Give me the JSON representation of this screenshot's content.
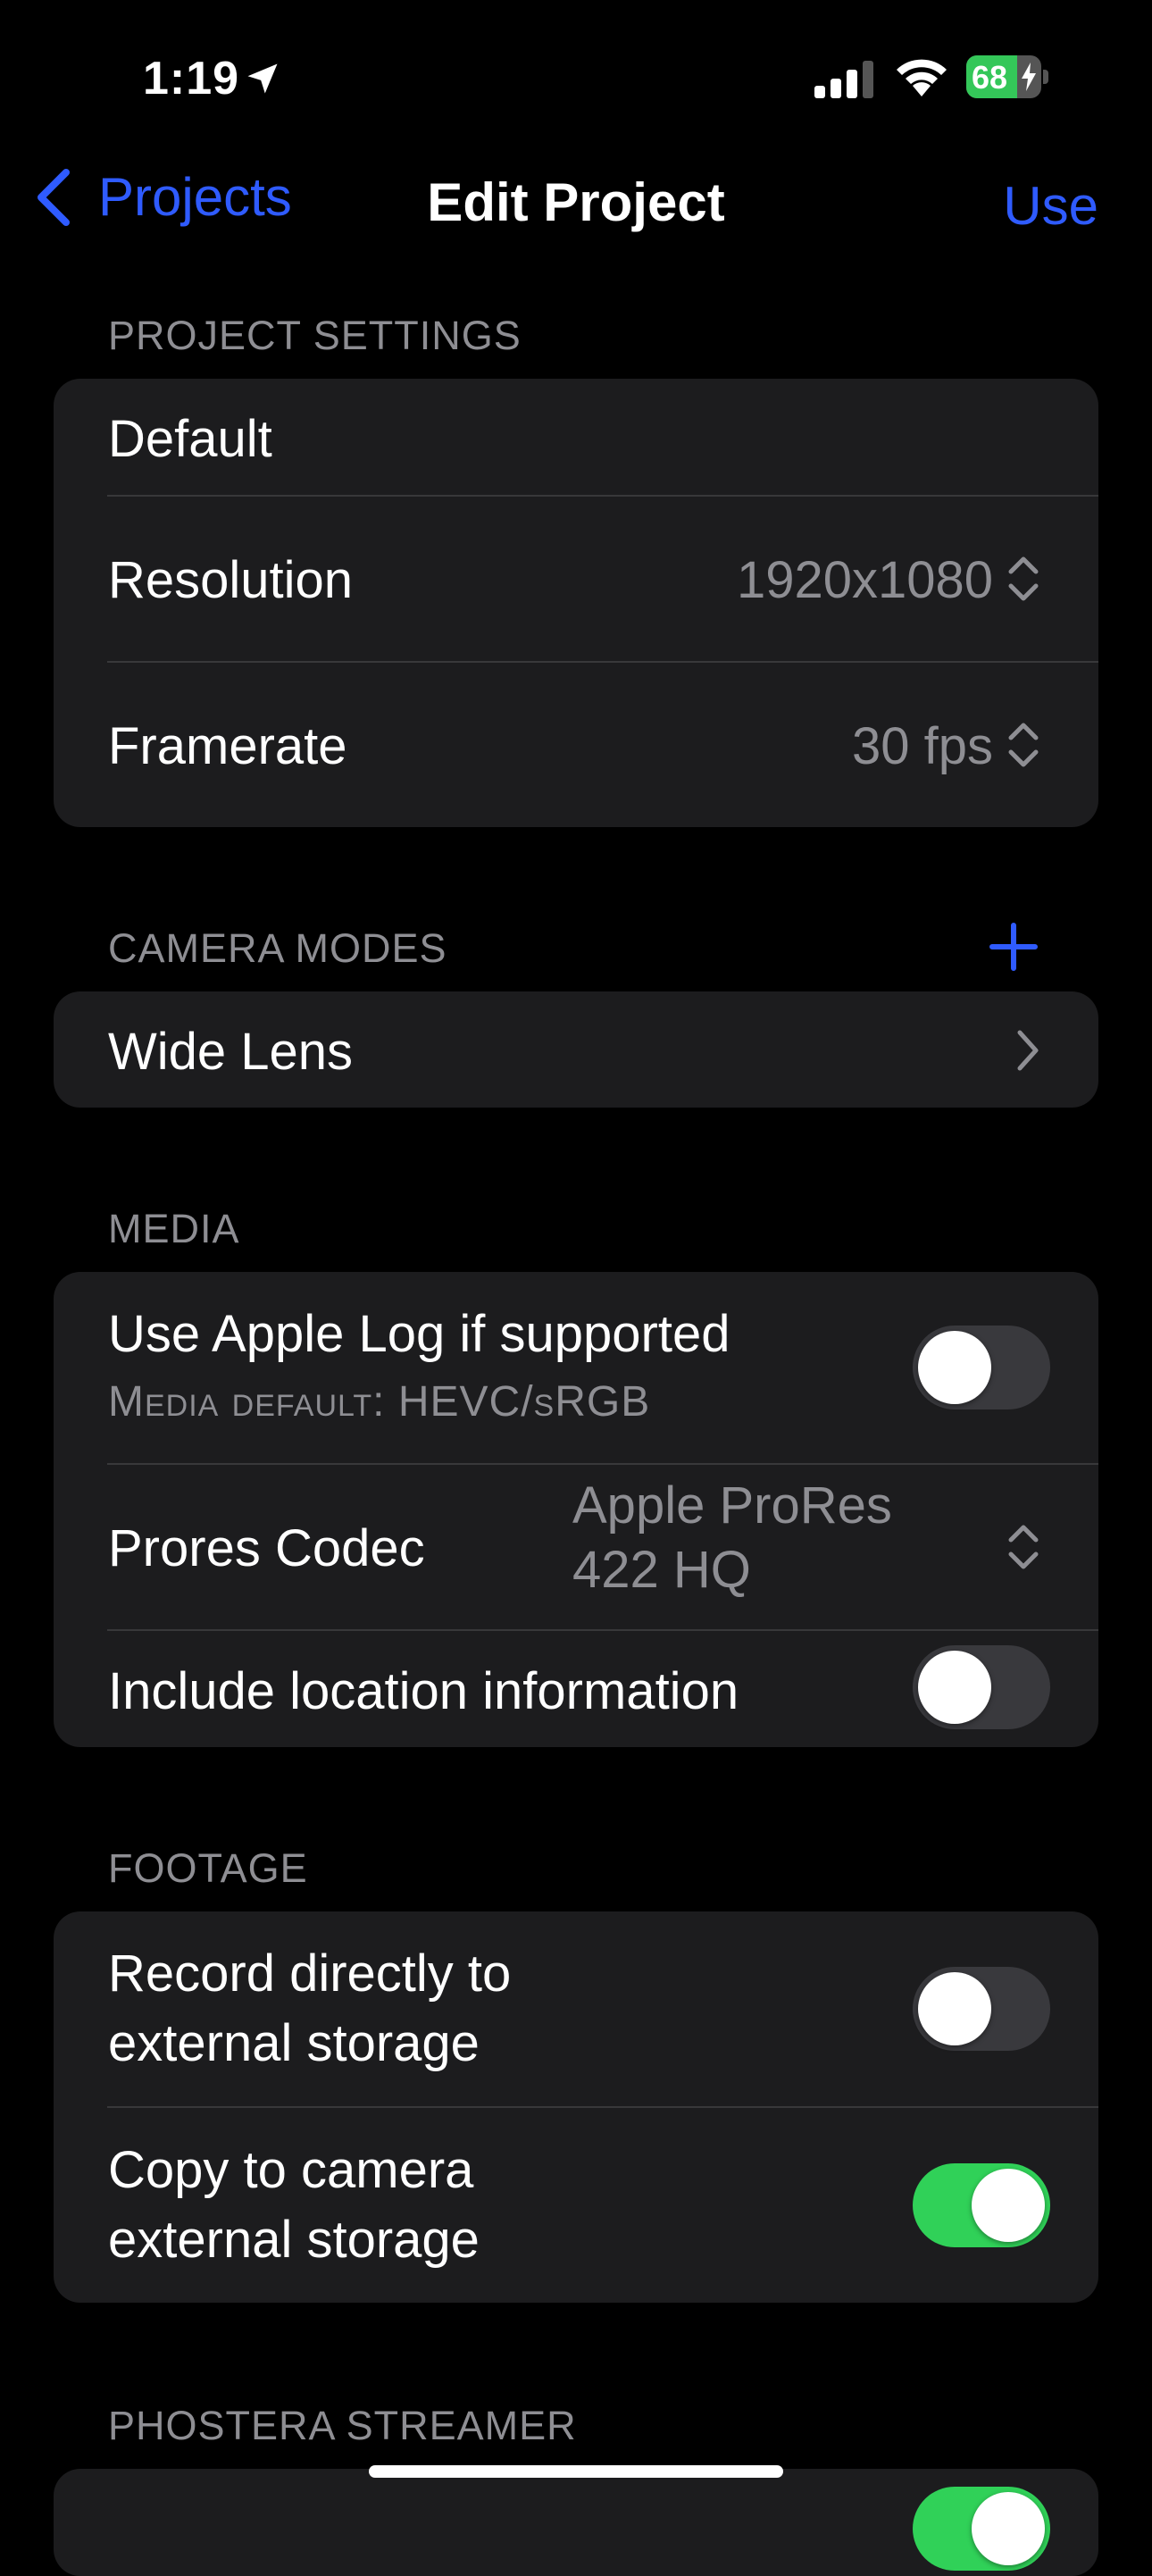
{
  "status_bar": {
    "time": "1:19",
    "battery": "68",
    "battery_level": 0.68
  },
  "nav": {
    "back_label": "Projects",
    "title": "Edit Project",
    "action_label": "Use"
  },
  "project_settings": {
    "header": "PROJECT SETTINGS",
    "name": "Default",
    "resolution_label": "Resolution",
    "resolution_value": "1920x1080",
    "framerate_label": "Framerate",
    "framerate_value": "30 fps"
  },
  "camera_modes": {
    "header": "CAMERA MODES",
    "items": [
      {
        "label": "Wide Lens"
      }
    ]
  },
  "media": {
    "header": "MEDIA",
    "apple_log_label": "Use Apple Log if supported",
    "apple_log_sublabel": "Media default: HEVC/sRGB",
    "apple_log_on": false,
    "prores_label": "Prores Codec",
    "prores_value_line1": "Apple ProRes",
    "prores_value_line2": "422 HQ",
    "location_label": "Include location information",
    "location_on": false
  },
  "footage": {
    "header": "FOOTAGE",
    "record_external_line1": "Record directly to",
    "record_external_line2": "external storage",
    "record_external_on": false,
    "copy_external_line1": "Copy to camera",
    "copy_external_line2": "external storage",
    "copy_external_on": true
  },
  "phostera": {
    "header": "PHOSTERA STREAMER"
  },
  "colors": {
    "accent": "#2f5bff",
    "toggle_on": "#30d158",
    "card_bg": "#1c1c1e",
    "secondary_text": "#8e8e93"
  }
}
